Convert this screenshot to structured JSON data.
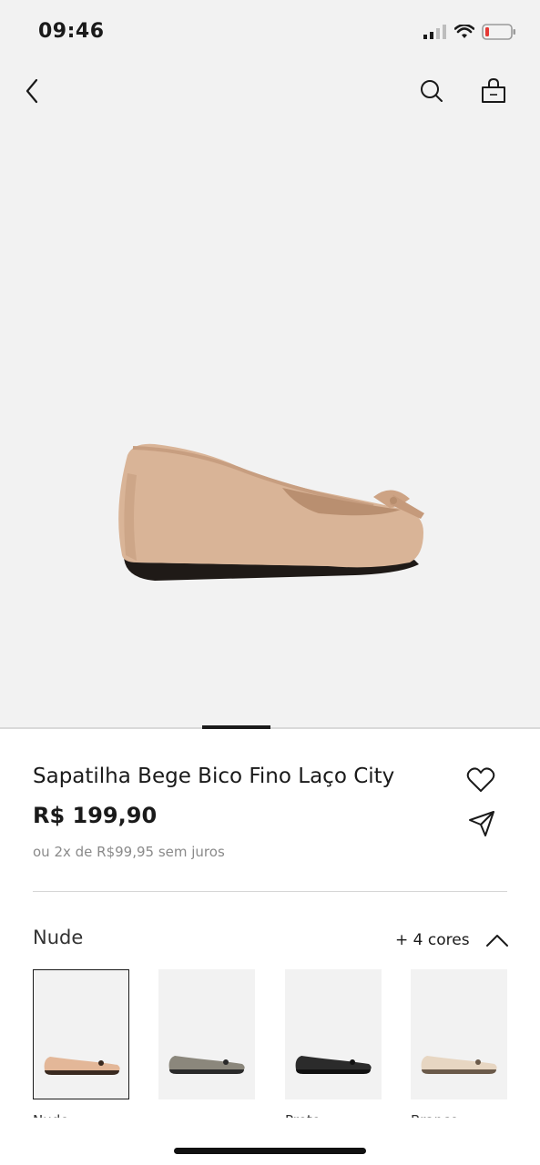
{
  "status_bar": {
    "time": "09:46"
  },
  "product": {
    "title": "Sapatilha Bege Bico Fino Laço City",
    "price": "R$ 199,90",
    "installments": "ou 2x de R$99,95 sem juros"
  },
  "colors": {
    "selected_label": "Nude",
    "more_label": "+ 4 cores",
    "swatches": [
      {
        "name": "Nude",
        "color": "#e3b798",
        "sole": "#3a2a20"
      },
      {
        "name": "",
        "color": "#8b877c",
        "sole": "#2a2a2a"
      },
      {
        "name": "Preto",
        "color": "#2b2b2b",
        "sole": "#111111"
      },
      {
        "name": "Branco",
        "color": "#e7d6c2",
        "sole": "#6b5a4a"
      }
    ]
  },
  "theme": {
    "hero_background": "#f2f2f2",
    "shoe_color": "#d9b497",
    "accent": "#1a1a1a"
  }
}
